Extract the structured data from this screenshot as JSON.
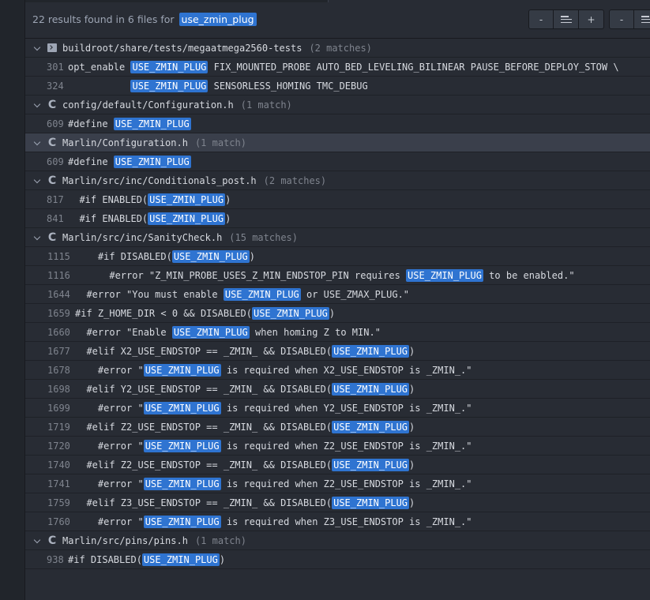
{
  "summary": {
    "prefix": "22 results found in 6 files for",
    "query": "use_zmin_plug"
  },
  "buttons": {
    "collapse_label": "-",
    "expand_label": "+",
    "collapse2_label": "-"
  },
  "files": [
    {
      "icon": "terminal-icon",
      "path": "buildroot/share/tests/megaatmega2560-tests",
      "count": "(2 matches)",
      "selected": false,
      "matches": [
        {
          "line": "301",
          "pre": "opt_enable ",
          "hl": "USE_ZMIN_PLUG",
          "post": " FIX_MOUNTED_PROBE AUTO_BED_LEVELING_BILINEAR PAUSE_BEFORE_DEPLOY_STOW \\"
        },
        {
          "line": "324",
          "pre": "           ",
          "hl": "USE_ZMIN_PLUG",
          "post": " SENSORLESS_HOMING TMC_DEBUG"
        }
      ]
    },
    {
      "icon": "c-file-icon",
      "path": "config/default/Configuration.h",
      "count": "(1 match)",
      "selected": false,
      "matches": [
        {
          "line": "609",
          "pre": "#define ",
          "hl": "USE_ZMIN_PLUG",
          "post": ""
        }
      ]
    },
    {
      "icon": "c-file-icon",
      "path": "Marlin/Configuration.h",
      "count": "(1 match)",
      "selected": true,
      "matches": [
        {
          "line": "609",
          "pre": "#define ",
          "hl": "USE_ZMIN_PLUG",
          "post": ""
        }
      ]
    },
    {
      "icon": "c-file-icon",
      "path": "Marlin/src/inc/Conditionals_post.h",
      "count": "(2 matches)",
      "selected": false,
      "matches": [
        {
          "line": "817",
          "pre": "  #if ENABLED(",
          "hl": "USE_ZMIN_PLUG",
          "post": ")"
        },
        {
          "line": "841",
          "pre": "  #if ENABLED(",
          "hl": "USE_ZMIN_PLUG",
          "post": ")"
        }
      ]
    },
    {
      "icon": "c-file-icon",
      "path": "Marlin/src/inc/SanityCheck.h",
      "count": "(15 matches)",
      "selected": false,
      "matches": [
        {
          "line": "1115",
          "pre": "    #if DISABLED(",
          "hl": "USE_ZMIN_PLUG",
          "post": ")"
        },
        {
          "line": "1116",
          "pre": "      #error \"Z_MIN_PROBE_USES_Z_MIN_ENDSTOP_PIN requires ",
          "hl": "USE_ZMIN_PLUG",
          "post": " to be enabled.\""
        },
        {
          "line": "1644",
          "pre": "  #error \"You must enable ",
          "hl": "USE_ZMIN_PLUG",
          "post": " or USE_ZMAX_PLUG.\""
        },
        {
          "line": "1659",
          "pre": "#if Z_HOME_DIR < 0 && DISABLED(",
          "hl": "USE_ZMIN_PLUG",
          "post": ")"
        },
        {
          "line": "1660",
          "pre": "  #error \"Enable ",
          "hl": "USE_ZMIN_PLUG",
          "post": " when homing Z to MIN.\""
        },
        {
          "line": "1677",
          "pre": "  #elif X2_USE_ENDSTOP == _ZMIN_ && DISABLED(",
          "hl": "USE_ZMIN_PLUG",
          "post": ")"
        },
        {
          "line": "1678",
          "pre": "    #error \"",
          "hl": "USE_ZMIN_PLUG",
          "post": " is required when X2_USE_ENDSTOP is _ZMIN_.\""
        },
        {
          "line": "1698",
          "pre": "  #elif Y2_USE_ENDSTOP == _ZMIN_ && DISABLED(",
          "hl": "USE_ZMIN_PLUG",
          "post": ")"
        },
        {
          "line": "1699",
          "pre": "    #error \"",
          "hl": "USE_ZMIN_PLUG",
          "post": " is required when Y2_USE_ENDSTOP is _ZMIN_.\""
        },
        {
          "line": "1719",
          "pre": "  #elif Z2_USE_ENDSTOP == _ZMIN_ && DISABLED(",
          "hl": "USE_ZMIN_PLUG",
          "post": ")"
        },
        {
          "line": "1720",
          "pre": "    #error \"",
          "hl": "USE_ZMIN_PLUG",
          "post": " is required when Z2_USE_ENDSTOP is _ZMIN_.\""
        },
        {
          "line": "1740",
          "pre": "  #elif Z2_USE_ENDSTOP == _ZMIN_ && DISABLED(",
          "hl": "USE_ZMIN_PLUG",
          "post": ")"
        },
        {
          "line": "1741",
          "pre": "    #error \"",
          "hl": "USE_ZMIN_PLUG",
          "post": " is required when Z2_USE_ENDSTOP is _ZMIN_.\""
        },
        {
          "line": "1759",
          "pre": "  #elif Z3_USE_ENDSTOP == _ZMIN_ && DISABLED(",
          "hl": "USE_ZMIN_PLUG",
          "post": ")"
        },
        {
          "line": "1760",
          "pre": "    #error \"",
          "hl": "USE_ZMIN_PLUG",
          "post": " is required when Z3_USE_ENDSTOP is _ZMIN_.\""
        }
      ]
    },
    {
      "icon": "c-file-icon",
      "path": "Marlin/src/pins/pins.h",
      "count": "(1 match)",
      "selected": false,
      "matches": [
        {
          "line": "938",
          "pre": "#if DISABLED(",
          "hl": "USE_ZMIN_PLUG",
          "post": ")"
        }
      ]
    }
  ]
}
